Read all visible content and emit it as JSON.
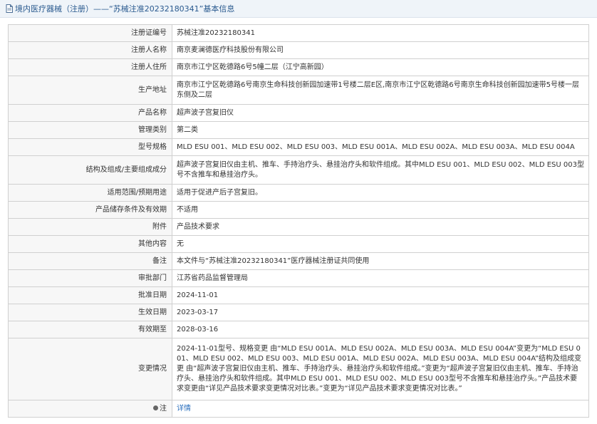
{
  "header": {
    "title": "境内医疗器械（注册）——“苏械注准20232180341”基本信息",
    "icon": "document-icon"
  },
  "rows": [
    {
      "label": "注册证编号",
      "value": "苏械注准20232180341"
    },
    {
      "label": "注册人名称",
      "value": "南京麦澜德医疗科技股份有限公司"
    },
    {
      "label": "注册人住所",
      "value": "南京市江宁区乾德路6号5幢二层（江宁高新园）"
    },
    {
      "label": "生产地址",
      "value": "南京市江宁区乾德路6号南京生命科技创新园加速带1号楼二层E区,南京市江宁区乾德路6号南京生命科技创新园加速带5号楼一层东侧及二层"
    },
    {
      "label": "产品名称",
      "value": "超声波子宫复旧仪"
    },
    {
      "label": "管理类别",
      "value": "第二类"
    },
    {
      "label": "型号规格",
      "value": "MLD ESU 001、MLD ESU 002、MLD ESU 003、MLD ESU 001A、MLD ESU 002A、MLD ESU 003A、MLD ESU 004A"
    },
    {
      "label": "结构及组成/主要组成成分",
      "value": "超声波子宫复旧仪由主机、推车、手持治疗头、悬挂治疗头和软件组成。其中MLD ESU 001、MLD ESU 002、MLD ESU 003型号不含推车和悬挂治疗头。"
    },
    {
      "label": "适用范围/预期用途",
      "value": "适用于促进产后子宫复旧。"
    },
    {
      "label": "产品储存条件及有效期",
      "value": "不适用"
    },
    {
      "label": "附件",
      "value": "产品技术要求"
    },
    {
      "label": "其他内容",
      "value": "无"
    },
    {
      "label": "备注",
      "value": "本文件与“苏械注准20232180341”医疗器械注册证共同使用"
    },
    {
      "label": "审批部门",
      "value": "江苏省药品监督管理局"
    },
    {
      "label": "批准日期",
      "value": "2024-11-01"
    },
    {
      "label": "生效日期",
      "value": "2023-03-17"
    },
    {
      "label": "有效期至",
      "value": "2028-03-16"
    },
    {
      "label": "变更情况",
      "value": "2024-11-01型号、规格变更 由“MLD ESU 001A、MLD ESU 002A、MLD ESU 003A、MLD ESU 004A”变更为“MLD ESU 001、MLD ESU 002、MLD ESU 003、MLD ESU 001A、MLD ESU 002A、MLD ESU 003A、MLD ESU 004A”结构及组成变更 由“超声波子宫复旧仪由主机、推车、手持治疗头、悬挂治疗头和软件组成。”变更为“超声波子宫复旧仪由主机、推车、手持治疗头、悬挂治疗头和软件组成。其中MLD ESU 001、MLD ESU 002、MLD ESU 003型号不含推车和悬挂治疗头。”产品技术要求变更由“详见产品技术要求变更情况对比表。”变更为“详见产品技术要求变更情况对比表。”"
    }
  ],
  "note_row": {
    "label": "注",
    "link_text": "详情",
    "icon": "bulb-icon"
  }
}
